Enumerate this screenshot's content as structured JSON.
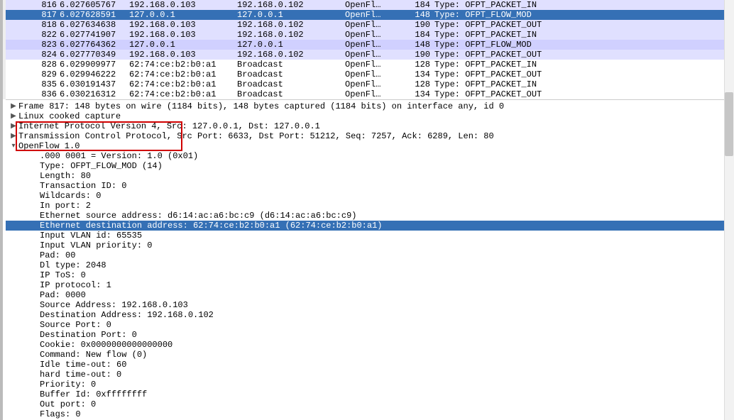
{
  "packets": [
    {
      "no": "816",
      "time": "6.027605767",
      "src": "192.168.0.103",
      "dst": "192.168.0.102",
      "prot": "OpenFl…",
      "len": "184",
      "info": "Type: OFPT_PACKET_IN",
      "cls": "alt1",
      "mark": ""
    },
    {
      "no": "817",
      "time": "6.027628591",
      "src": "127.0.0.1",
      "dst": "127.0.0.1",
      "prot": "OpenFl…",
      "len": "148",
      "info": "Type: OFPT_FLOW_MOD",
      "cls": "selected",
      "mark": ""
    },
    {
      "no": "818",
      "time": "6.027634638",
      "src": "192.168.0.103",
      "dst": "192.168.0.102",
      "prot": "OpenFl…",
      "len": "190",
      "info": "Type: OFPT_PACKET_OUT",
      "cls": "alt1",
      "mark": ""
    },
    {
      "no": "822",
      "time": "6.027741907",
      "src": "192.168.0.103",
      "dst": "192.168.0.102",
      "prot": "OpenFl…",
      "len": "184",
      "info": "Type: OFPT_PACKET_IN",
      "cls": "alt1",
      "mark": ""
    },
    {
      "no": "823",
      "time": "6.027764362",
      "src": "127.0.0.1",
      "dst": "127.0.0.1",
      "prot": "OpenFl…",
      "len": "148",
      "info": "Type: OFPT_FLOW_MOD",
      "cls": "alt2",
      "mark": ""
    },
    {
      "no": "824",
      "time": "6.027770349",
      "src": "192.168.0.103",
      "dst": "192.168.0.102",
      "prot": "OpenFl…",
      "len": "190",
      "info": "Type: OFPT_PACKET_OUT",
      "cls": "alt1",
      "mark": ""
    },
    {
      "no": "828",
      "time": "6.029909977",
      "src": "62:74:ce:b2:b0:a1",
      "dst": "Broadcast",
      "prot": "OpenFl…",
      "len": "128",
      "info": "Type: OFPT_PACKET_IN",
      "cls": "plain",
      "mark": ""
    },
    {
      "no": "829",
      "time": "6.029946222",
      "src": "62:74:ce:b2:b0:a1",
      "dst": "Broadcast",
      "prot": "OpenFl…",
      "len": "134",
      "info": "Type: OFPT_PACKET_OUT",
      "cls": "plain",
      "mark": ""
    },
    {
      "no": "835",
      "time": "6.030191437",
      "src": "62:74:ce:b2:b0:a1",
      "dst": "Broadcast",
      "prot": "OpenFl…",
      "len": "128",
      "info": "Type: OFPT_PACKET_IN",
      "cls": "plain",
      "mark": ""
    },
    {
      "no": "836",
      "time": "6.030216312",
      "src": "62:74:ce:b2:b0:a1",
      "dst": "Broadcast",
      "prot": "OpenFl…",
      "len": "134",
      "info": "Type: OFPT_PACKET_OUT",
      "cls": "plain",
      "mark": ""
    }
  ],
  "tree": {
    "frame": "Frame 817: 148 bytes on wire (1184 bits), 148 bytes captured (1184 bits) on interface any, id 0",
    "linux": "Linux cooked capture",
    "ip": "Internet Protocol Version 4, Src: 127.0.0.1, Dst: 127.0.0.1",
    "tcp": "Transmission Control Protocol, Src Port: 6633, Dst Port: 51212, Seq: 7257, Ack: 6289, Len: 80",
    "of": "OpenFlow 1.0"
  },
  "of_fields": [
    ".000 0001 = Version: 1.0 (0x01)",
    "Type: OFPT_FLOW_MOD (14)",
    "Length: 80",
    "Transaction ID: 0",
    "Wildcards: 0",
    "In port: 2",
    "Ethernet source address: d6:14:ac:a6:bc:c9 (d6:14:ac:a6:bc:c9)",
    "Ethernet destination address: 62:74:ce:b2:b0:a1 (62:74:ce:b2:b0:a1)",
    "Input VLAN id: 65535",
    "Input VLAN priority: 0",
    "Pad: 00",
    "Dl type: 2048",
    "IP ToS: 0",
    "IP protocol: 1",
    "Pad: 0000",
    "Source Address: 192.168.0.103",
    "Destination Address: 192.168.0.102",
    "Source Port: 0",
    "Destination Port: 0",
    "Cookie: 0x0000000000000000",
    "Command: New flow (0)",
    "Idle time-out: 60",
    "hard time-out: 0",
    "Priority: 0",
    "Buffer Id: 0xffffffff",
    "Out port: 0",
    "Flags: 0"
  ],
  "of_selected_index": 7
}
